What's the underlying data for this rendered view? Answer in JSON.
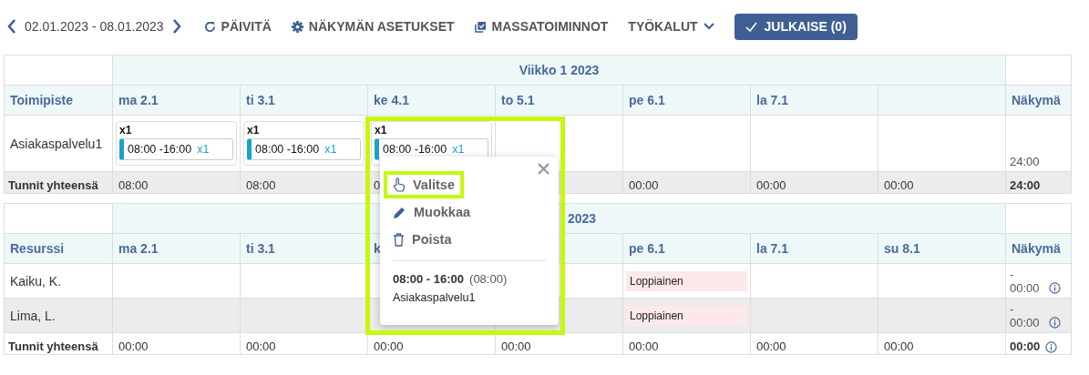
{
  "toolbar": {
    "date_range": "02.01.2023 - 08.01.2023",
    "actions": [
      {
        "label": "PÄIVITÄ",
        "kind": "refresh"
      },
      {
        "label": "NÄKYMÄN ASETUKSET",
        "kind": "gear"
      },
      {
        "label": "MASSATOIMINNOT",
        "kind": "stack"
      },
      {
        "label": "TYÖKALUT",
        "kind": "dropdown"
      }
    ],
    "publish_button": "JULKAISE (0)"
  },
  "tables": [
    {
      "week_label": "Viikko 1 2023",
      "week_shifted": false,
      "corner_label": "Toimipiste",
      "days": [
        {
          "kind": "day",
          "label": "ma 2.1"
        },
        {
          "kind": "day",
          "label": "ti 3.1"
        },
        {
          "kind": "day",
          "label": "ke 4.1"
        },
        {
          "kind": "day",
          "label": "to 5.1"
        },
        {
          "kind": "day",
          "label": "pe 6.1"
        },
        {
          "kind": "day",
          "label": "la 7.1"
        },
        {
          "kind": "blank"
        }
      ],
      "view_label": "Näkymä",
      "rows": [
        {
          "name": "Asiakaspalvelu1",
          "shaded": false,
          "cells": [
            {
              "kind": "shift",
              "count": "x1",
              "time": "08:00 -16:00",
              "slot_count": "x1"
            },
            {
              "kind": "shift",
              "count": "x1",
              "time": "08:00 -16:00",
              "slot_count": "x1"
            },
            {
              "kind": "shift",
              "count": "x1",
              "time": "08:00 -16:00",
              "slot_count": "x1"
            },
            {
              "kind": "blank"
            },
            {
              "kind": "blank"
            },
            {
              "kind": "blank"
            },
            {
              "kind": "blank"
            }
          ],
          "view": {
            "value": "24:00"
          }
        }
      ],
      "totals": {
        "label": "Tunnit yhteensä",
        "shaded": true,
        "values": [
          {
            "kind": "hours",
            "text": "08:00"
          },
          {
            "kind": "hours",
            "text": "08:00"
          },
          {
            "kind": "hours",
            "text": "0"
          },
          {
            "kind": "blank"
          },
          {
            "kind": "hours",
            "text": "00:00"
          },
          {
            "kind": "hours",
            "text": "00:00"
          },
          {
            "kind": "hours",
            "text": "00:00"
          }
        ],
        "total": "24:00"
      }
    },
    {
      "week_label": "2023",
      "week_shifted": true,
      "corner_label": "Resurssi",
      "days": [
        {
          "kind": "day",
          "label": "ma 2.1"
        },
        {
          "kind": "day",
          "label": "ti 3.1"
        },
        {
          "kind": "day",
          "label": "k"
        },
        {
          "kind": "blank"
        },
        {
          "kind": "day",
          "label": "pe 6.1"
        },
        {
          "kind": "day",
          "label": "la 7.1"
        },
        {
          "kind": "day",
          "label": "su 8.1"
        }
      ],
      "view_label": "Näkymä",
      "rows": [
        {
          "name": "Kaiku, K.",
          "shaded": false,
          "cells": [
            {
              "kind": "blank"
            },
            {
              "kind": "blank"
            },
            {
              "kind": "blank"
            },
            {
              "kind": "blank"
            },
            {
              "kind": "holiday",
              "label": "Loppiainen"
            },
            {
              "kind": "blank"
            },
            {
              "kind": "blank"
            }
          ],
          "view": {
            "prefix": "-",
            "value": "00:00",
            "info": true
          }
        },
        {
          "name": "Lima, L.",
          "shaded": true,
          "cells": [
            {
              "kind": "blank"
            },
            {
              "kind": "blank"
            },
            {
              "kind": "blank"
            },
            {
              "kind": "blank"
            },
            {
              "kind": "holiday",
              "label": "Loppiainen"
            },
            {
              "kind": "blank"
            },
            {
              "kind": "blank"
            }
          ],
          "view": {
            "prefix": "-",
            "value": "00:00",
            "info": true
          }
        }
      ],
      "totals": {
        "label": "Tunnit yhteensä",
        "shaded": false,
        "values": [
          {
            "kind": "hours",
            "text": "00:00"
          },
          {
            "kind": "hours",
            "text": "00:00"
          },
          {
            "kind": "hours",
            "text": "00:00"
          },
          {
            "kind": "hours",
            "text": "00:00"
          },
          {
            "kind": "hours",
            "text": "00:00"
          },
          {
            "kind": "hours",
            "text": "00:00"
          },
          {
            "kind": "hours",
            "text": "00:00"
          }
        ],
        "total": "00:00",
        "info": true
      }
    }
  ],
  "popup": {
    "framed": true,
    "actions": [
      {
        "label": "Valitse",
        "kind": "select",
        "highlighted": true
      },
      {
        "label": "Muokkaa",
        "kind": "edit",
        "highlighted": false
      },
      {
        "label": "Poista",
        "kind": "delete",
        "highlighted": false
      }
    ],
    "time": "08:00 - 16:00",
    "duration": "(08:00)",
    "place": "Asiakaspalvelu1"
  }
}
